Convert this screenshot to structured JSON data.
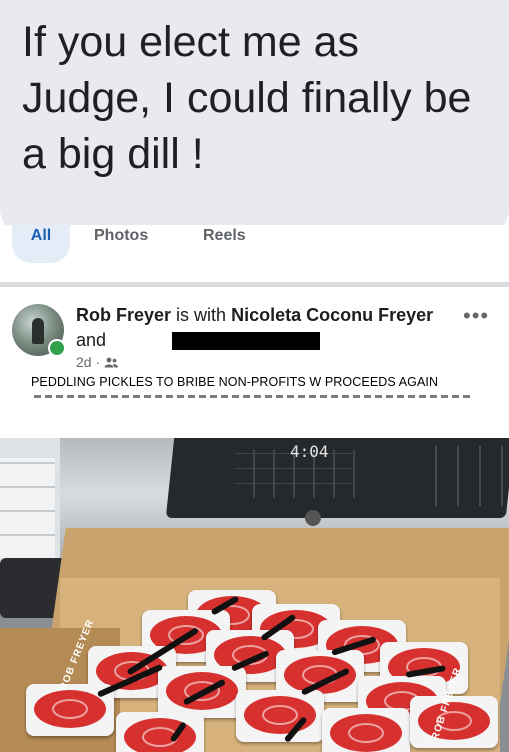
{
  "bubble": {
    "text": "If you elect me as Judge, I could finally be a big dill !"
  },
  "tabs": [
    {
      "label": "All"
    },
    {
      "label": "Photos"
    },
    {
      "label": "Reels"
    }
  ],
  "post": {
    "author": "Rob Freyer",
    "with_text": "is with",
    "tagged": "Nicoleta Coconu Freyer",
    "and_text": "and",
    "time": "2d",
    "audience_icon": "friends-icon",
    "more_label": "•••",
    "caption": "PEDDLING PICKLES TO BRIBE NON-PROFITS W PROCEEDS AGAIN"
  },
  "photo": {
    "display_readout": "4:04",
    "cup_side_left": "ROB FREYER",
    "cup_side_right": "ROB FREYER"
  },
  "colors": {
    "bubble_bg": "#e9e9ee",
    "online": "#31a24c",
    "lid_red": "#d6312f"
  }
}
